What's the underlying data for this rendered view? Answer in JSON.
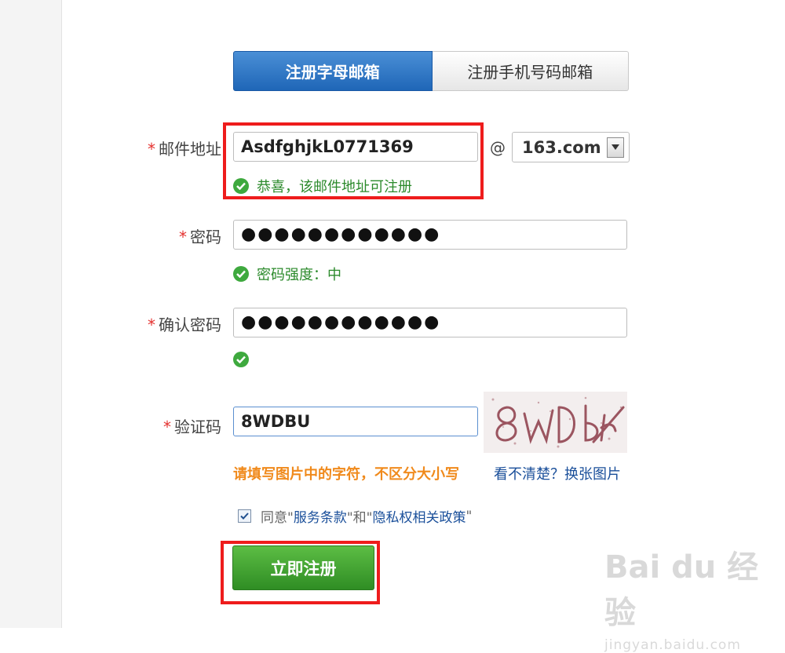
{
  "tabs": [
    {
      "label": "注册字母邮箱",
      "active": true
    },
    {
      "label": "注册手机号码邮箱",
      "active": false
    }
  ],
  "email": {
    "label": "邮件地址",
    "value": "AsdfghjkL0771369",
    "at": "@",
    "domain": "163.com",
    "hint": "恭喜，该邮件地址可注册"
  },
  "password": {
    "label": "密码",
    "masked": "●●●●●●●●●●●●",
    "strength": "密码强度：中"
  },
  "confirm": {
    "label": "确认密码",
    "masked": "●●●●●●●●●●●●"
  },
  "captcha": {
    "label": "验证码",
    "value": "8WDBU",
    "hint": "请填写图片中的字符，不区分大小写",
    "refresh": "看不清楚？换张图片"
  },
  "agreement": {
    "checked": true,
    "prefix": "同意\"",
    "terms": "服务条款",
    "middle": "\"和\"",
    "privacy": "隐私权相关政策",
    "suffix": "\""
  },
  "submit_label": "立即注册",
  "required_mark": "*",
  "watermark": {
    "main": "Bai du 经验",
    "sub": "jingyan.baidu.com"
  },
  "colors": {
    "accent_blue": "#1f66b7",
    "success_green": "#2b8a2b",
    "required_red": "#e4312f",
    "highlight_red": "#ee1c1c",
    "submit_green": "#3a9a2c"
  }
}
